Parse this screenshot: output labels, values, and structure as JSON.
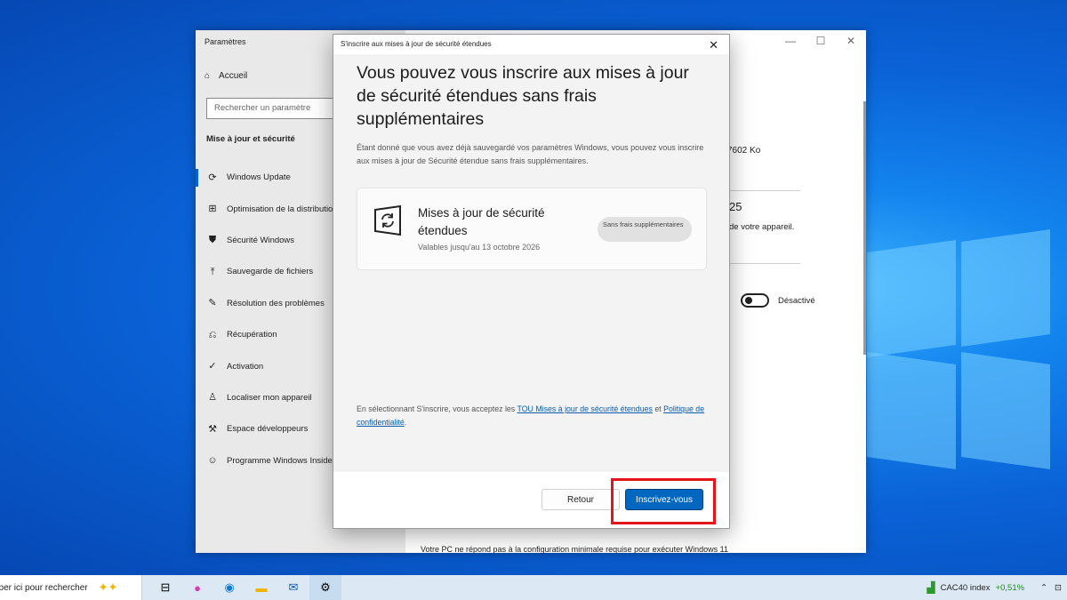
{
  "settings": {
    "title": "Paramètres",
    "home": "Accueil",
    "search_placeholder": "Rechercher un paramètre",
    "section": "Mise à jour et sécurité",
    "nav": [
      {
        "label": "Windows Update",
        "icon": "refresh-icon"
      },
      {
        "label": "Optimisation de la distribution",
        "icon": "delivery-icon"
      },
      {
        "label": "Sécurité Windows",
        "icon": "shield-icon"
      },
      {
        "label": "Sauvegarde de fichiers",
        "icon": "upload-icon"
      },
      {
        "label": "Résolution des problèmes",
        "icon": "wrench-icon"
      },
      {
        "label": "Récupération",
        "icon": "recovery-icon"
      },
      {
        "label": "Activation",
        "icon": "check-circle-icon"
      },
      {
        "label": "Localiser mon appareil",
        "icon": "person-pin-icon"
      },
      {
        "label": "Espace développeurs",
        "icon": "tools-icon"
      },
      {
        "label": "Programme Windows Insider",
        "icon": "insider-cat-icon"
      }
    ],
    "right": {
      "size": "7602 Ko",
      "year": "25",
      "device": "de votre appareil.",
      "toggle_label": "Désactivé",
      "bottom": "Votre PC ne répond pas à la configuration minimale requise pour exécuter Windows 11"
    }
  },
  "dialog": {
    "title": "S'inscrire aux mises à jour de sécurité étendues",
    "heading": "Vous pouvez vous inscrire aux mises à jour de sécurité étendues sans frais supplémentaires",
    "description": "Étant donné que vous avez déjà sauvegardé vos paramètres Windows, vous pouvez vous inscrire aux mises à jour de Sécurité étendue sans frais supplémentaires.",
    "card": {
      "title": "Mises à jour de sécurité étendues",
      "subtitle": "Valables jusqu'au 13 octobre 2026",
      "badge": "Sans frais supplémentaires"
    },
    "terms": {
      "prefix": "En sélectionnant S'inscrire, vous acceptez les ",
      "link1": "TOU Mises à jour de sécurité étendues",
      "middle": " et ",
      "link2": "Politique de confidentialité",
      "suffix": "."
    },
    "buttons": {
      "back": "Retour",
      "enroll": "Inscrivez-vous"
    }
  },
  "taskbar": {
    "search": "Taper ici pour rechercher",
    "ticker": "CAC40 index",
    "change": "+0,51%",
    "colors": {
      "accent": "#0067c0",
      "highlight": "#e3141c"
    }
  }
}
